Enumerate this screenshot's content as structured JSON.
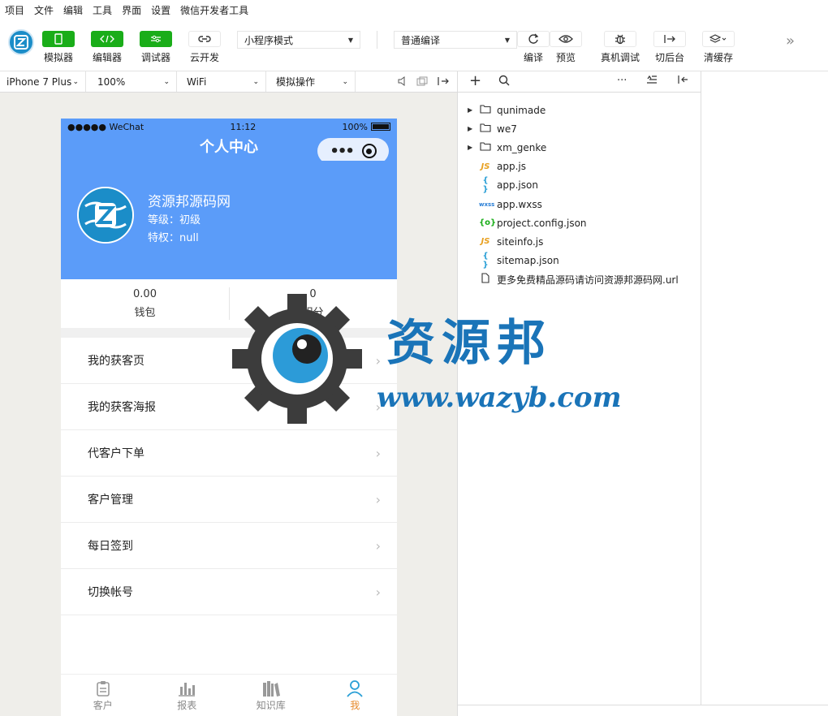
{
  "menubar": [
    "项目",
    "文件",
    "编辑",
    "工具",
    "界面",
    "设置",
    "微信开发者工具"
  ],
  "toolbar": {
    "simulator_label": "模拟器",
    "editor_label": "编辑器",
    "debugger_label": "调试器",
    "cloud_label": "云开发",
    "mode_select": "小程序模式",
    "compile_select": "普通编译",
    "compile_label": "编译",
    "preview_label": "预览",
    "remote_debug_label": "真机调试",
    "background_label": "切后台",
    "clear_cache_label": "清缓存"
  },
  "simbar": {
    "device": "iPhone 7 Plus",
    "zoom": "100%",
    "network": "WiFi",
    "action": "模拟操作"
  },
  "phone": {
    "status_left": "●●●●● WeChat",
    "status_time": "11:12",
    "status_right": "100%",
    "nav_title": "个人中心",
    "profile_name": "资源邦源码网",
    "profile_level": "等级：初级",
    "profile_privilege": "特权：null",
    "stats": [
      {
        "value": "0.00",
        "label": "钱包"
      },
      {
        "value": "0",
        "label": "积分"
      }
    ],
    "menu": [
      {
        "label": "我的获客页"
      },
      {
        "label": "我的获客海报"
      },
      {
        "label": "代客户下单"
      },
      {
        "label": "客户管理"
      },
      {
        "label": "每日签到"
      },
      {
        "label": "切换帐号"
      }
    ],
    "tabs": [
      {
        "label": "客户",
        "icon": "clipboard-icon"
      },
      {
        "label": "报表",
        "icon": "bar-chart-icon"
      },
      {
        "label": "知识库",
        "icon": "books-icon"
      },
      {
        "label": "我",
        "icon": "user-icon"
      }
    ],
    "accent": "#5b9cf9",
    "active_tab_color": "#e6892a"
  },
  "filetree": {
    "items": [
      {
        "name": "qunimade",
        "type": "folder",
        "icon_text": ""
      },
      {
        "name": "we7",
        "type": "folder",
        "icon_text": ""
      },
      {
        "name": "xm_genke",
        "type": "folder",
        "icon_text": ""
      },
      {
        "name": "app.js",
        "type": "js",
        "icon_text": "JS"
      },
      {
        "name": "app.json",
        "type": "json",
        "icon_text": "{ }"
      },
      {
        "name": "app.wxss",
        "type": "wxss",
        "icon_text": "wxss"
      },
      {
        "name": "project.config.json",
        "type": "config",
        "icon_text": "{o}"
      },
      {
        "name": "siteinfo.js",
        "type": "js",
        "icon_text": "JS"
      },
      {
        "name": "sitemap.json",
        "type": "json",
        "icon_text": "{ }"
      },
      {
        "name": "更多免费精品源码请访问资源邦源码网.url",
        "type": "file",
        "icon_text": ""
      }
    ]
  },
  "watermark": {
    "title": "资源邦",
    "url": "www.wazyb.com"
  }
}
